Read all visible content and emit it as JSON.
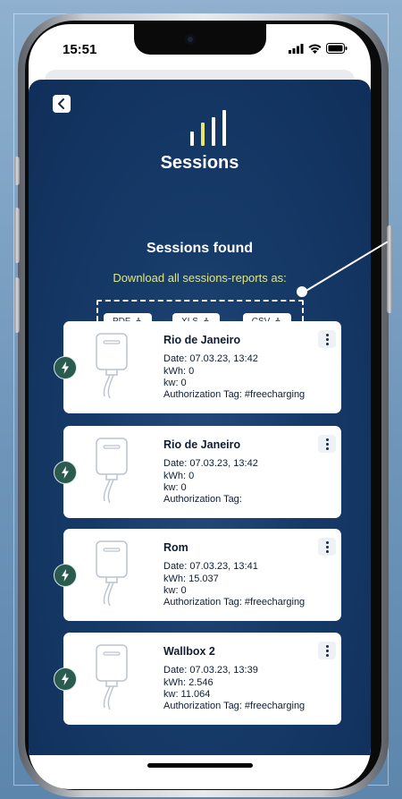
{
  "status": {
    "time": "15:51"
  },
  "header": {
    "title": "Sessions"
  },
  "summary": {
    "heading": "Sessions found",
    "download_label": "Download all sessions-reports as:"
  },
  "downloads": [
    {
      "label": "PDF"
    },
    {
      "label": "XLS"
    },
    {
      "label": "CSV"
    }
  ],
  "sessions": [
    {
      "name": "Rio de Janeiro",
      "date": "Date: 07.03.23, 13:42",
      "kwh": "kWh: 0",
      "kw": "kw: 0",
      "tag": "Authorization Tag: #freecharging"
    },
    {
      "name": "Rio de Janeiro",
      "date": "Date: 07.03.23, 13:42",
      "kwh": "kWh: 0",
      "kw": "kw: 0",
      "tag": "Authorization Tag:"
    },
    {
      "name": "Rom",
      "date": "Date: 07.03.23, 13:41",
      "kwh": "kWh: 15.037",
      "kw": "kw: 0",
      "tag": "Authorization Tag: #freecharging"
    },
    {
      "name": "Wallbox 2",
      "date": "Date: 07.03.23, 13:39",
      "kwh": "kWh: 2.546",
      "kw": "kw: 11.064",
      "tag": "Authorization Tag: #freecharging"
    }
  ],
  "colors": {
    "panel": "#163a68",
    "accent": "#dfe58a",
    "bolt": "#2b5a4f"
  }
}
